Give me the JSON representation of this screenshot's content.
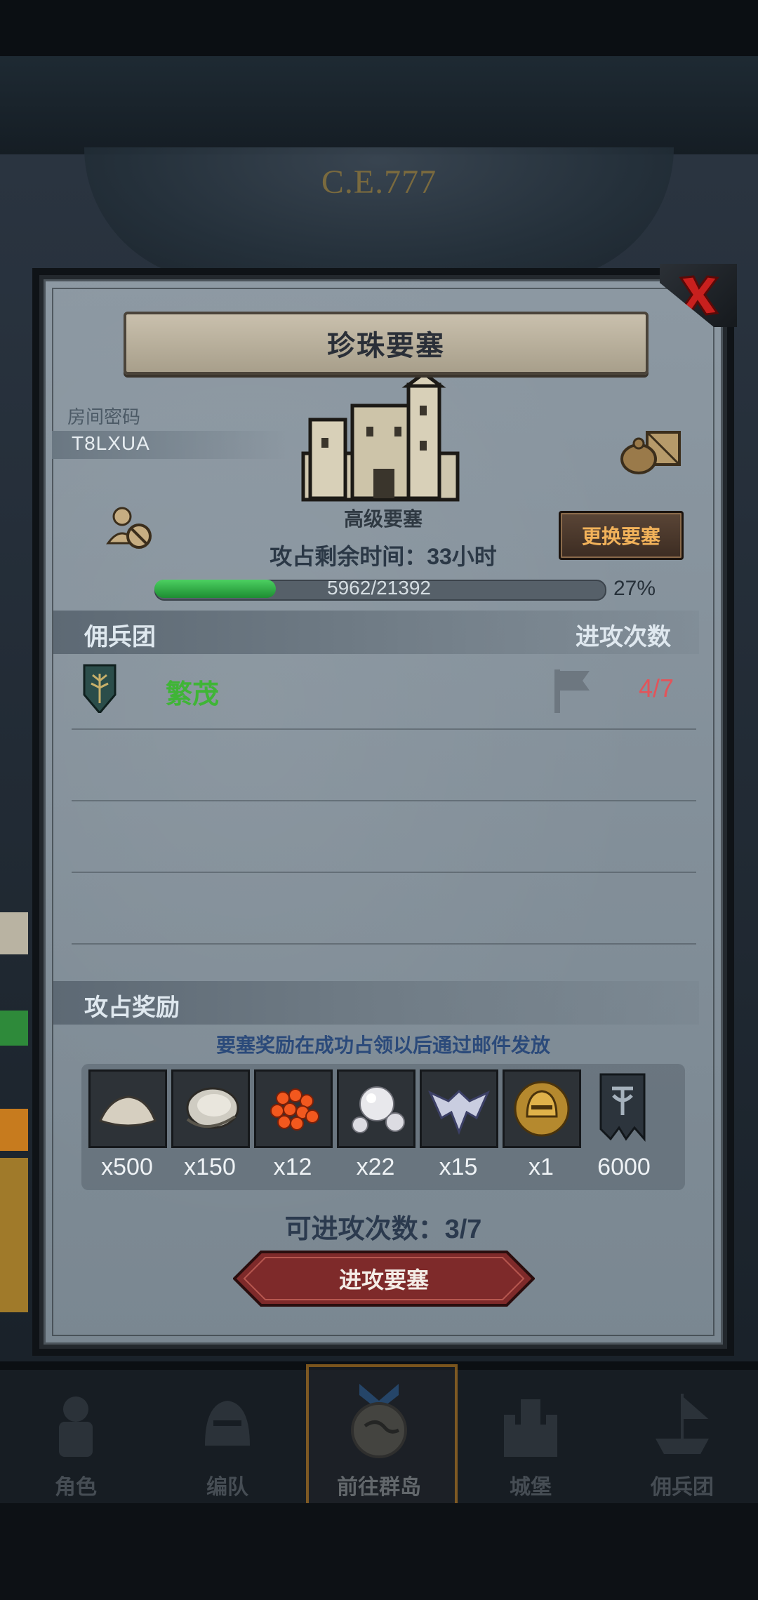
{
  "background": {
    "year": "C.E.777"
  },
  "dialog": {
    "title": "珍珠要塞",
    "room_label": "房间密码",
    "room_code": "T8LXUA",
    "fortress_level": "高级要塞",
    "change_button": "更换要塞",
    "remaining_time": "攻占剩余时间：33小时",
    "progress": {
      "text": "5962/21392",
      "current": 5962,
      "total": 21392,
      "percent_label": "27%",
      "fraction": 0.27
    },
    "mercenary_section": {
      "title": "佣兵团",
      "right_title": "进攻次数"
    },
    "mercenaries": [
      {
        "name": "繁茂",
        "attacks": "4/7",
        "name_color": "#3fb536"
      }
    ],
    "reward_section": {
      "title": "攻占奖励",
      "note": "要塞奖励在成功占领以后通过邮件发放"
    },
    "rewards": [
      {
        "icon": "sand-pile-icon",
        "qty": "x500"
      },
      {
        "icon": "oyster-icon",
        "qty": "x150"
      },
      {
        "icon": "fish-roe-icon",
        "qty": "x12"
      },
      {
        "icon": "pearl-icon",
        "qty": "x22"
      },
      {
        "icon": "winged-emblem-icon",
        "qty": "x15"
      },
      {
        "icon": "golden-helmet-icon",
        "qty": "x1"
      },
      {
        "icon": "banner-icon",
        "qty": "6000"
      }
    ],
    "attack_count": "可进攻次数：3/7",
    "attack_button": "进攻要塞"
  },
  "bottom_nav": [
    {
      "label": "角色",
      "icon": "knight-icon"
    },
    {
      "label": "编队",
      "icon": "helmet-icon"
    },
    {
      "label": "前往群岛",
      "icon": "globe-icon",
      "active": true
    },
    {
      "label": "城堡",
      "icon": "castle-icon"
    },
    {
      "label": "佣兵团",
      "icon": "mercenary-ship-icon"
    }
  ],
  "colors": {
    "accent_gold": "#f2b25a",
    "progress_green": "#3fb536",
    "attack_red": "#e2545a",
    "button_red": "#8a2b2b"
  }
}
